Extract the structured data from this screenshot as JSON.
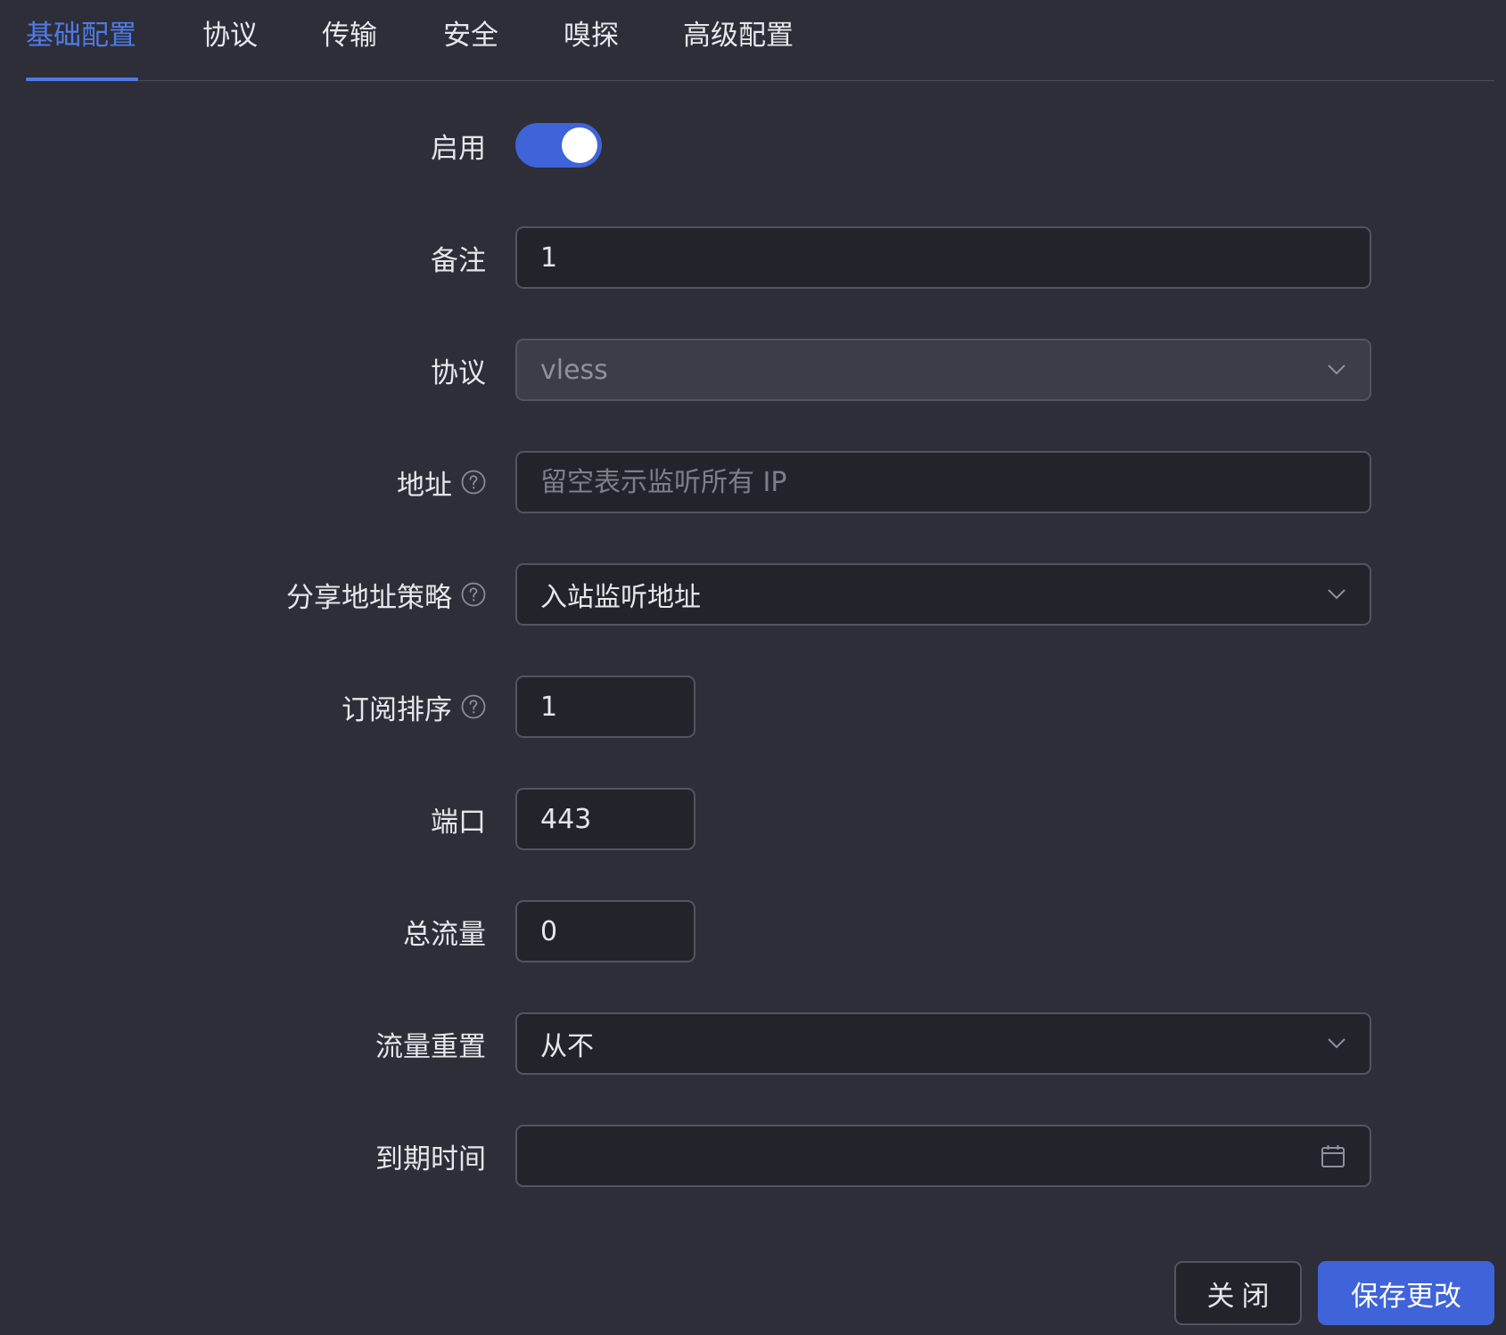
{
  "tabs": [
    {
      "label": "基础配置",
      "active": true
    },
    {
      "label": "协议",
      "active": false
    },
    {
      "label": "传输",
      "active": false
    },
    {
      "label": "安全",
      "active": false
    },
    {
      "label": "嗅探",
      "active": false
    },
    {
      "label": "高级配置",
      "active": false
    }
  ],
  "form": {
    "enable": {
      "label": "启用",
      "value": true
    },
    "remark": {
      "label": "备注",
      "value": "1"
    },
    "protocol": {
      "label": "协议",
      "value": "vless"
    },
    "address": {
      "label": "地址",
      "value": "",
      "placeholder": "留空表示监听所有 IP"
    },
    "share_policy": {
      "label": "分享地址策略",
      "value": "入站监听地址"
    },
    "sub_order": {
      "label": "订阅排序",
      "value": "1"
    },
    "port": {
      "label": "端口",
      "value": "443"
    },
    "total_traffic": {
      "label": "总流量",
      "value": "0"
    },
    "traffic_reset": {
      "label": "流量重置",
      "value": "从不"
    },
    "expiry": {
      "label": "到期时间",
      "value": ""
    }
  },
  "buttons": {
    "close": "关闭",
    "save": "保存更改"
  },
  "colors": {
    "accent": "#4f7ae6",
    "primary": "#3f63d8",
    "background": "#2d2e38",
    "input_bg": "#23242b"
  },
  "icons": {
    "help": "question-circle-icon",
    "dropdown": "chevron-down-icon",
    "date": "calendar-icon"
  }
}
